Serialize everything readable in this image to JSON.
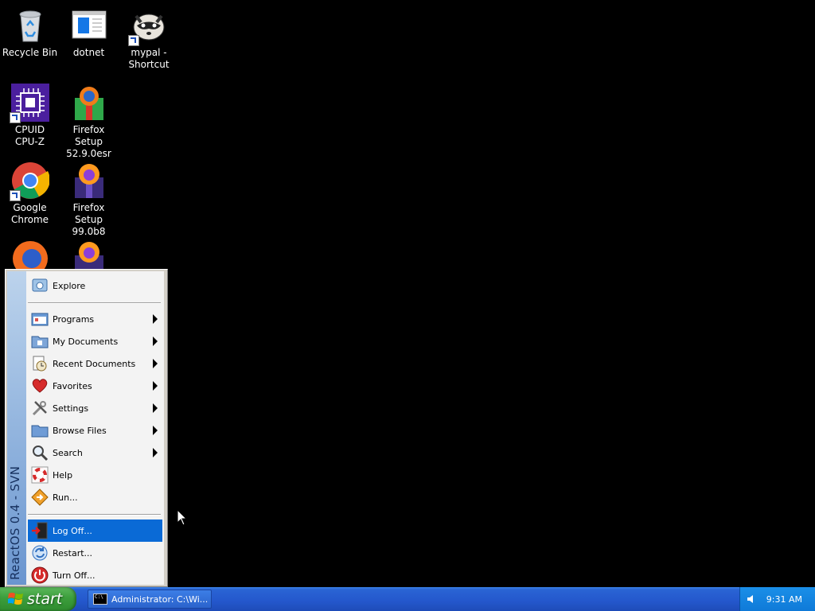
{
  "desktop": {
    "icons": [
      {
        "label": "Recycle Bin"
      },
      {
        "label": "dotnet"
      },
      {
        "label": "mypal - Shortcut"
      },
      {
        "label": "CPUID CPU-Z"
      },
      {
        "label": "Firefox Setup 52.9.0esr"
      },
      {
        "label": "Google Chrome"
      },
      {
        "label": "Firefox Setup 99.0b8"
      }
    ]
  },
  "start_menu": {
    "banner": "ReactOS  0.4 - SVN",
    "items": [
      {
        "label": "Explore",
        "icon": "explore-icon"
      },
      {
        "label": "Programs",
        "icon": "programs-icon",
        "submenu": true
      },
      {
        "label": "My Documents",
        "icon": "my-documents-icon",
        "submenu": true
      },
      {
        "label": "Recent Documents",
        "icon": "recent-documents-icon",
        "submenu": true
      },
      {
        "label": "Favorites",
        "icon": "heart-icon",
        "submenu": true
      },
      {
        "label": "Settings",
        "icon": "settings-icon",
        "submenu": true
      },
      {
        "label": "Browse Files",
        "icon": "folder-icon",
        "submenu": true
      },
      {
        "label": "Search",
        "icon": "magnifier-icon",
        "submenu": true
      },
      {
        "label": "Help",
        "icon": "help-lifebuoy-icon"
      },
      {
        "label": "Run...",
        "icon": "run-icon"
      },
      {
        "label": "Log Off...",
        "icon": "log-off-icon",
        "selected": true
      },
      {
        "label": "Restart...",
        "icon": "restart-icon"
      },
      {
        "label": "Turn Off...",
        "icon": "power-icon"
      }
    ]
  },
  "taskbar": {
    "start_label": "start",
    "tasks": [
      {
        "label": "Administrator: C:\\Wi..."
      }
    ],
    "clock": "9:31 AM"
  },
  "colors": {
    "desktop": "#000000",
    "taskbar": "#2457cc",
    "start_button": "#3c9e3c",
    "selection": "#0a6ad6"
  }
}
